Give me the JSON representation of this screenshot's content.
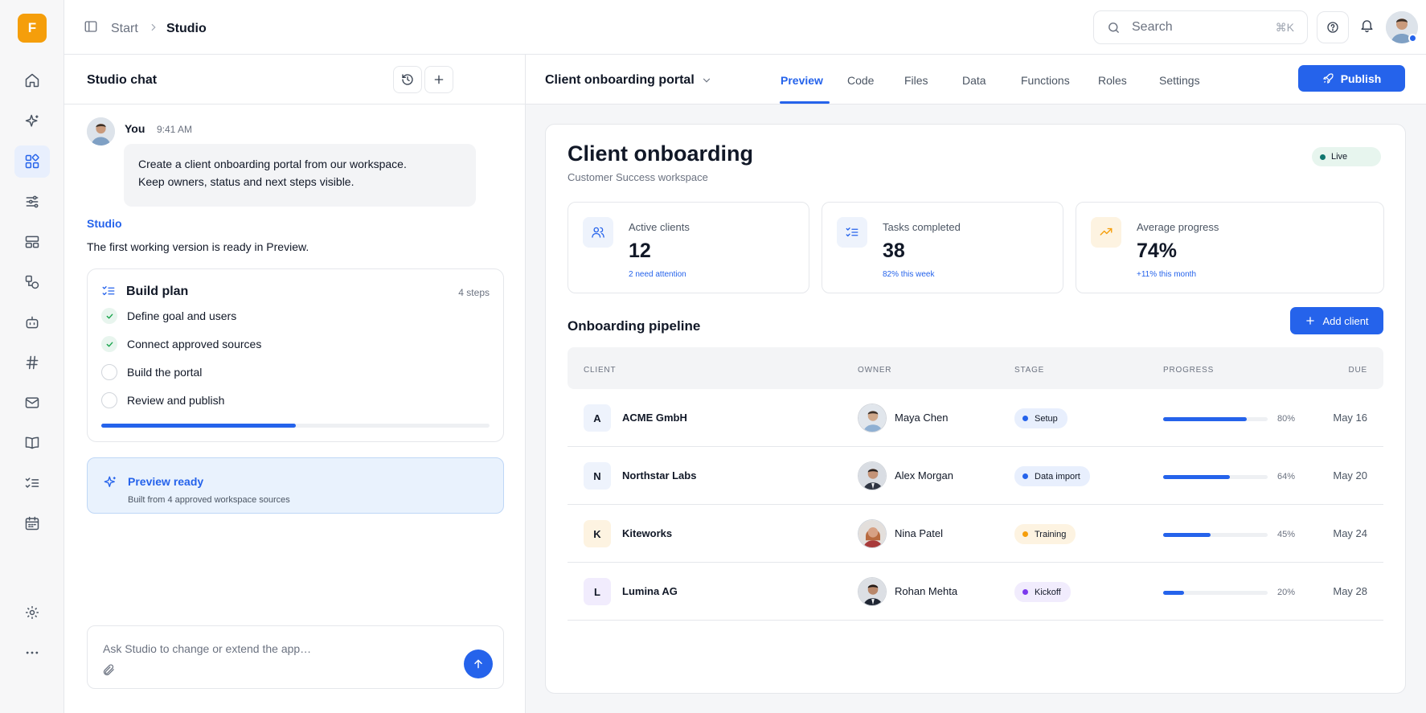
{
  "brand": {
    "logo_letter": "F",
    "accent": "#2563eb",
    "logo_color": "#f59e0b"
  },
  "rail": {
    "items": [
      {
        "name": "home-icon",
        "active": false
      },
      {
        "name": "sparkles-icon",
        "active": false
      },
      {
        "name": "apps-icon",
        "active": true
      },
      {
        "name": "sliders-icon",
        "active": false
      },
      {
        "name": "layout-icon",
        "active": false
      },
      {
        "name": "shapes-icon",
        "active": false
      },
      {
        "name": "bot-icon",
        "active": false
      },
      {
        "name": "hash-icon",
        "active": false
      },
      {
        "name": "mail-icon",
        "active": false
      },
      {
        "name": "book-icon",
        "active": false
      },
      {
        "name": "checklist-icon",
        "active": false
      },
      {
        "name": "calendar-icon",
        "active": false
      }
    ],
    "bottom": [
      "settings-icon",
      "more-icon"
    ]
  },
  "topbar": {
    "breadcrumb": [
      "Start",
      "Studio"
    ],
    "search": {
      "placeholder": "Search",
      "shortcut": "⌘K"
    }
  },
  "chat": {
    "title": "Studio chat",
    "message": {
      "author": "You",
      "time": "9:41 AM",
      "lines": [
        "Create a client onboarding portal from our workspace.",
        "Keep owners, status and next steps visible."
      ]
    },
    "reply": {
      "author": "Studio",
      "text": "The first working version is ready in Preview."
    },
    "plan": {
      "title": "Build plan",
      "count": "4 steps",
      "steps": [
        {
          "label": "Define goal and users",
          "done": true
        },
        {
          "label": "Connect approved sources",
          "done": true
        },
        {
          "label": "Build the portal",
          "done": false
        },
        {
          "label": "Review and publish",
          "done": false
        }
      ],
      "progress": 0.5
    },
    "preview_card": {
      "title": "Preview ready",
      "subtitle": "Built from 4 approved workspace sources"
    },
    "composer": {
      "placeholder": "Ask Studio to change or extend the app…"
    }
  },
  "app": {
    "name": "Client onboarding portal",
    "tabs": [
      "Preview",
      "Code",
      "Files",
      "Data",
      "Functions",
      "Roles",
      "Settings"
    ],
    "active_tab": "Preview",
    "publish_label": "Publish"
  },
  "preview": {
    "title": "Client onboarding",
    "subtitle": "Customer Success workspace",
    "status": "Live",
    "stats": [
      {
        "label": "Active clients",
        "value": "12",
        "note": "2 need attention",
        "icon": "users-icon"
      },
      {
        "label": "Tasks completed",
        "value": "38",
        "note": "82% this week",
        "icon": "checklist-icon"
      },
      {
        "label": "Average progress",
        "value": "74%",
        "note": "+11% this month",
        "icon": "trending-up-icon"
      }
    ],
    "pipeline": {
      "title": "Onboarding pipeline",
      "add_label": "Add client",
      "columns": [
        "CLIENT",
        "OWNER",
        "STAGE",
        "PROGRESS",
        "DUE"
      ],
      "rows": [
        {
          "initial": "A",
          "client": "ACME GmbH",
          "owner": "Maya Chen",
          "stage": "Setup",
          "stage_color": "#2563eb",
          "stage_bg": "#e8effd",
          "badge_bg": "#eef3fc",
          "progress": 80,
          "progress_label": "80%",
          "due": "May 16"
        },
        {
          "initial": "N",
          "client": "Northstar Labs",
          "owner": "Alex Morgan",
          "stage": "Data import",
          "stage_color": "#2563eb",
          "stage_bg": "#e8effd",
          "badge_bg": "#eef3fc",
          "progress": 64,
          "progress_label": "64%",
          "due": "May 20"
        },
        {
          "initial": "K",
          "client": "Kiteworks",
          "owner": "Nina Patel",
          "stage": "Training",
          "stage_color": "#f59e0b",
          "stage_bg": "#fdf3e1",
          "badge_bg": "#fdf3e1",
          "progress": 45,
          "progress_label": "45%",
          "due": "May 24"
        },
        {
          "initial": "L",
          "client": "Lumina AG",
          "owner": "Rohan Mehta",
          "stage": "Kickoff",
          "stage_color": "#7c3aed",
          "stage_bg": "#f1ecfd",
          "badge_bg": "#f1ecfd",
          "progress": 20,
          "progress_label": "20%",
          "due": "May 28"
        }
      ]
    }
  }
}
